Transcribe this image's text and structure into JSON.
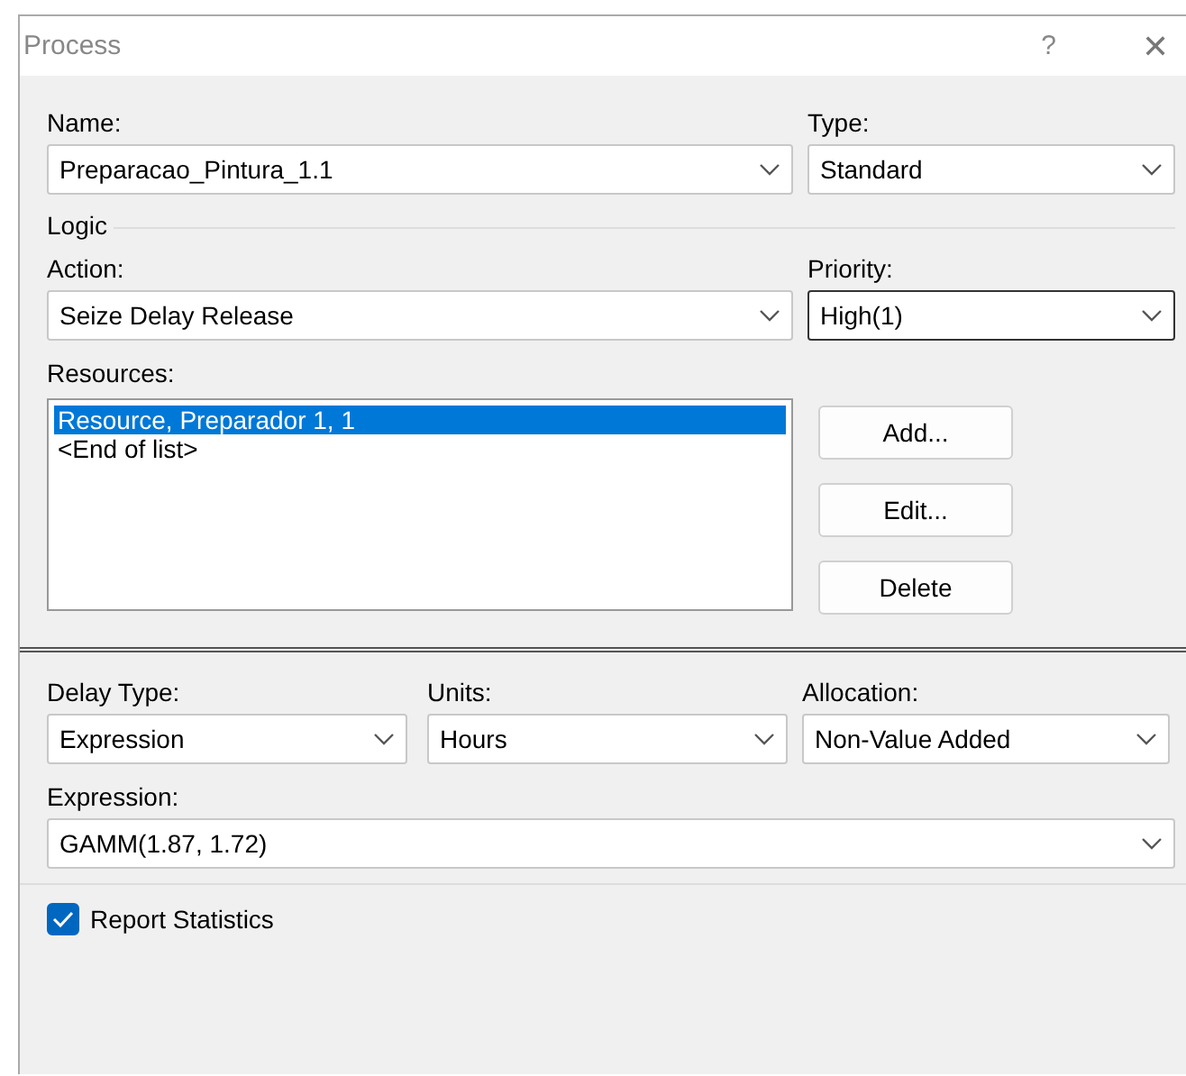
{
  "window": {
    "title": "Process",
    "help": "?",
    "close": "✕"
  },
  "name": {
    "label": "Name:",
    "value": "Preparacao_Pintura_1.1",
    "focused": false
  },
  "type": {
    "label": "Type:",
    "value": "Standard",
    "focused": false
  },
  "logic": {
    "title": "Logic",
    "action": {
      "label": "Action:",
      "value": "Seize Delay Release",
      "focused": false
    },
    "priority": {
      "label": "Priority:",
      "value": "High(1)",
      "focused": true
    },
    "resources": {
      "label": "Resources:",
      "items": [
        {
          "text": "Resource, Preparador 1, 1",
          "selected": true
        },
        {
          "text": "<End of list>",
          "selected": false
        }
      ]
    },
    "buttons": [
      "Add...",
      "Edit...",
      "Delete"
    ]
  },
  "delay_type": {
    "label": "Delay Type:",
    "value": "Expression",
    "focused": false
  },
  "units": {
    "label": "Units:",
    "value": "Hours",
    "focused": false
  },
  "allocation": {
    "label": "Allocation:",
    "value": "Non-Value Added",
    "focused": false
  },
  "expression": {
    "label": "Expression:",
    "value": "GAMM(1.87, 1.72)",
    "focused": false
  },
  "report_statistics": {
    "label": "Report Statistics",
    "checked": true
  }
}
